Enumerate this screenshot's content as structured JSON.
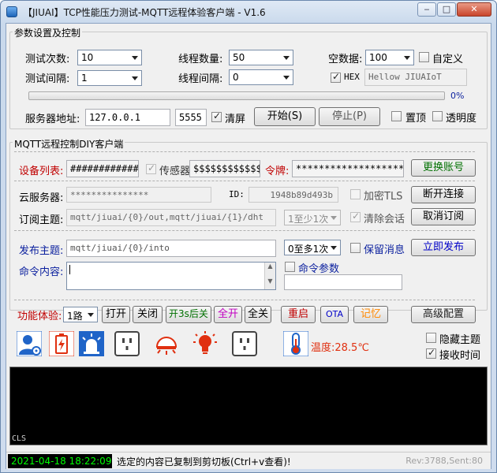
{
  "window": {
    "title": "【JIUAI】TCP性能压力测试-MQTT远程体验客户端 - V1.6",
    "minimize": "‒",
    "maximize": "□",
    "close": "✕"
  },
  "params": {
    "group_title": "参数设置及控制",
    "test_count_label": "测试次数:",
    "test_count_value": "10",
    "thread_count_label": "线程数量:",
    "thread_count_value": "50",
    "empty_data_label": "空数据:",
    "empty_data_value": "100",
    "custom_label": "自定义",
    "test_interval_label": "测试间隔:",
    "test_interval_value": "1",
    "thread_interval_label": "线程间隔:",
    "thread_interval_value": "0",
    "hex_label": "HEX",
    "hex_text": "Hellow JIUAIoT",
    "progress_label": "0%",
    "progress_fraction": 0,
    "server_label": "服务器地址:",
    "server_ip": "127.0.0.1",
    "server_port": "5555",
    "clear_screen_label": "清屏",
    "start_button": "开始(S)",
    "stop_button": "停止(P)",
    "top_label": "置顶",
    "transparency_label": "透明度"
  },
  "mqtt": {
    "group_title": "MQTT远程控制DIY客户端",
    "device_list_label": "设备列表:",
    "device_list_value": "############",
    "sensor_label": "传感器",
    "sensor_value": "$$$$$$$$$$$$$",
    "token_label": "令牌:",
    "token_value": "************************",
    "switch_account_button": "更换账号",
    "cloud_server_label": "云服务器:",
    "cloud_server_value": "***************",
    "id_label": "ID:",
    "id_value": "1948b89d493b",
    "tls_label": "加密TLS",
    "disconnect_button": "断开连接",
    "subscribe_label": "订阅主题:",
    "subscribe_value": "mqtt/jiuai/{0}/out,mqtt/jiuai/{1}/dht",
    "sub_qos_value": "1至少1次",
    "clear_session_label": "清除会话",
    "unsubscribe_button": "取消订阅",
    "publish_label": "发布主题:",
    "publish_value": "mqtt/jiuai/{0}/into",
    "pub_qos_value": "0至多1次",
    "retain_label": "保留消息",
    "publish_button": "立即发布",
    "command_label": "命令内容:",
    "command_value": "",
    "command_param_label": "命令参数",
    "command_param_value": ""
  },
  "functions": {
    "label": "功能体验:",
    "channel_value": "1路",
    "open": "打开",
    "close": "关闭",
    "open_3s_close": "开3s后关",
    "all_on": "全开",
    "all_off": "全关",
    "restart": "重启",
    "ota": "OTA",
    "remember": "记忆",
    "advanced": "高级配置"
  },
  "icons": {
    "temperature_label": "温度:28.5℃",
    "hide_topic_label": "隐藏主题",
    "receive_time_label": "接收时间"
  },
  "terminal": {
    "cls_label": "CLS"
  },
  "status": {
    "datetime": "2021-04-18 18:22:09",
    "message": "选定的内容已复制到剪切板(Ctrl+v查看)!",
    "counters": "Rev:3788,Sent:80"
  },
  "colors": {
    "accent_blue": "#1f64c8",
    "warning_red": "#e03010",
    "terminal_bg": "#000000",
    "status_green": "#00ff00"
  }
}
